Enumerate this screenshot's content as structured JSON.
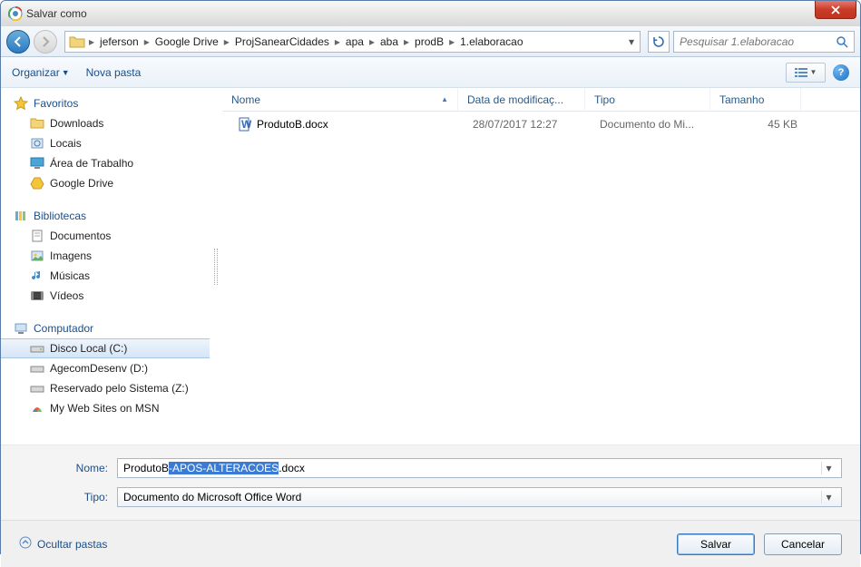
{
  "title": "Salvar como",
  "breadcrumb": [
    "jeferson",
    "Google Drive",
    "ProjSanearCidades",
    "apa",
    "aba",
    "prodB",
    "1.elaboracao"
  ],
  "search": {
    "placeholder": "Pesquisar 1.elaboracao"
  },
  "toolbar": {
    "organize": "Organizar",
    "new_folder": "Nova pasta"
  },
  "columns": {
    "name": "Nome",
    "date": "Data de modificaç...",
    "type": "Tipo",
    "size": "Tamanho"
  },
  "sidebar": {
    "favorites": {
      "label": "Favoritos",
      "items": [
        "Downloads",
        "Locais",
        "Área de Trabalho",
        "Google Drive"
      ]
    },
    "libraries": {
      "label": "Bibliotecas",
      "items": [
        "Documentos",
        "Imagens",
        "Músicas",
        "Vídeos"
      ]
    },
    "computer": {
      "label": "Computador",
      "items": [
        "Disco Local (C:)",
        "AgecomDesenv (D:)",
        "Reservado pelo Sistema (Z:)",
        "My Web Sites on MSN"
      ]
    }
  },
  "files": [
    {
      "name": "ProdutoB.docx",
      "date": "28/07/2017 12:27",
      "type": "Documento do Mi...",
      "size": "45 KB"
    }
  ],
  "form": {
    "name_label": "Nome:",
    "type_label": "Tipo:",
    "filename_prefix": "ProdutoB",
    "filename_selected": "-APOS-ALTERACOES",
    "filename_suffix": ".docx",
    "filetype": "Documento do Microsoft Office Word"
  },
  "footer": {
    "hide_folders": "Ocultar pastas",
    "save": "Salvar",
    "cancel": "Cancelar"
  }
}
